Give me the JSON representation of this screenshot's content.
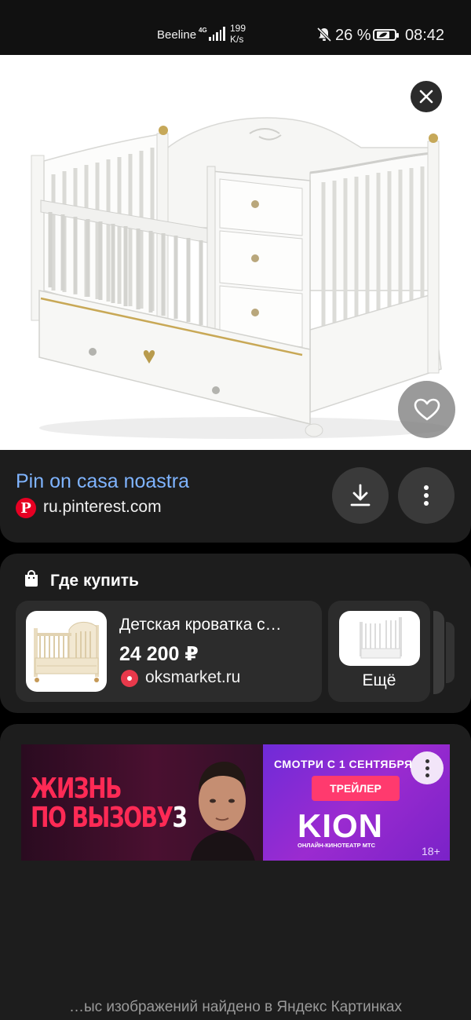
{
  "status_bar": {
    "carrier": "Beeline",
    "network_type": "4G",
    "speed_value": "199",
    "speed_unit": "K/s",
    "battery_percent": "26 %",
    "time": "08:42"
  },
  "hero": {
    "close_icon": "close-icon",
    "favorite_icon": "heart-icon"
  },
  "source": {
    "title": "Pin on casa noastra",
    "logo_letter": "P",
    "domain": "ru.pinterest.com",
    "download_icon": "download-icon",
    "more_icon": "more-vertical-icon"
  },
  "where_to_buy": {
    "title": "Где купить",
    "product": {
      "name": "Детская кроватка с…",
      "price": "24 200 ₽",
      "shop": "oksmarket.ru"
    },
    "more_label": "Ещё"
  },
  "ad": {
    "title_line1": "ЖИЗНЬ",
    "title_line2": "ПО ВЫЗОВУ",
    "title_number": "3",
    "subtitle": "СМОТРИ С 1 СЕНТЯБРЯ",
    "trailer_button": "ТРЕЙЛЕР",
    "brand": "KION",
    "brand_subtitle": "ОНЛАЙН-КИНОТЕАТР МТС",
    "age_rating": "18+"
  },
  "footer": {
    "note": "…ыс изображений найдено в Яндекс Картинках"
  },
  "colors": {
    "background": "#000000",
    "card": "#1d1d1d",
    "link_blue": "#7fb4ff",
    "pinterest_red": "#e60023",
    "ad_pink": "#ff2a55",
    "ad_purple": "#8b2bd4"
  }
}
